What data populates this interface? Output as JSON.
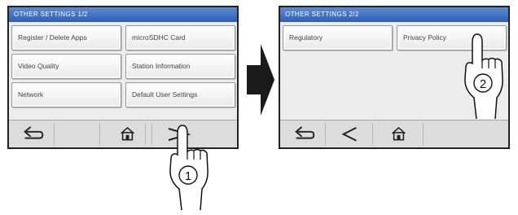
{
  "screens": [
    {
      "title": "OTHER SETTINGS  1/2",
      "buttons": [
        "Register / Delete Apps",
        "microSDHC Card",
        "Video Quality",
        "Station Information",
        "Network",
        "Default User Settings"
      ],
      "toolbar": [
        "back-icon",
        "home-icon",
        "next-icon"
      ]
    },
    {
      "title": "OTHER SETTINGS  2/2",
      "buttons": [
        "Regulatory",
        "Privacy Policy"
      ],
      "toolbar": [
        "back-icon",
        "previous-icon",
        "home-icon"
      ]
    }
  ],
  "callouts": [
    "1",
    "2"
  ]
}
